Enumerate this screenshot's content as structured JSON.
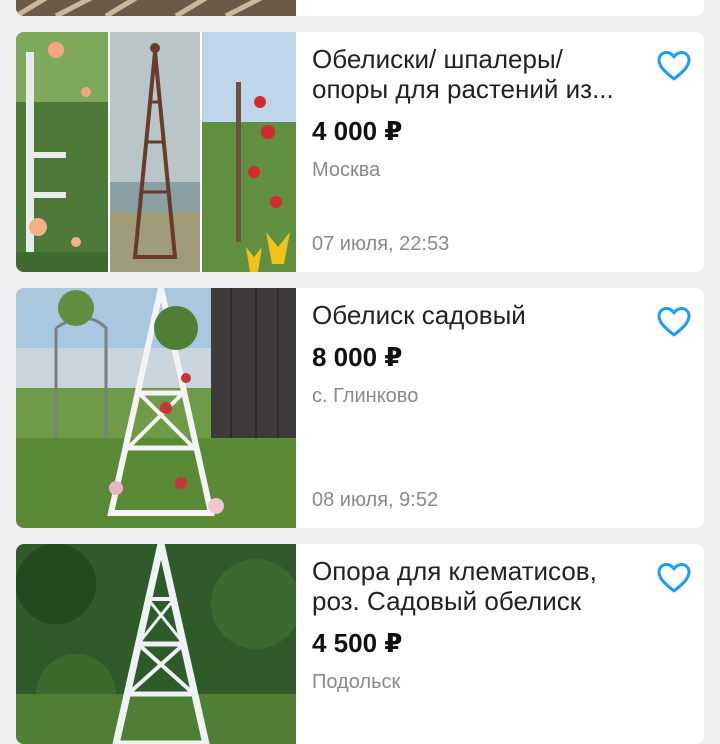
{
  "listings": [
    {
      "title_line1": "Обелиски/ шпалеры/",
      "title_line2": "опоры для растений из...",
      "price": "4 000 ₽",
      "location": "Москва",
      "date": "07 июля, 22:53"
    },
    {
      "title_line1": "Обелиск садовый",
      "title_line2": "",
      "price": "8 000 ₽",
      "location": "с. Глинково",
      "date": "08 июля, 9:52"
    },
    {
      "title_line1": "Опора для клематисов,",
      "title_line2": "роз. Садовый обелиск",
      "price": "4 500 ₽",
      "location": "Подольск",
      "date": ""
    }
  ],
  "icons": {
    "favorite": "heart-outline-icon"
  },
  "colors": {
    "accent": "#1a9ff0",
    "background": "#efeff1",
    "muted_text": "#8a8a8a"
  }
}
